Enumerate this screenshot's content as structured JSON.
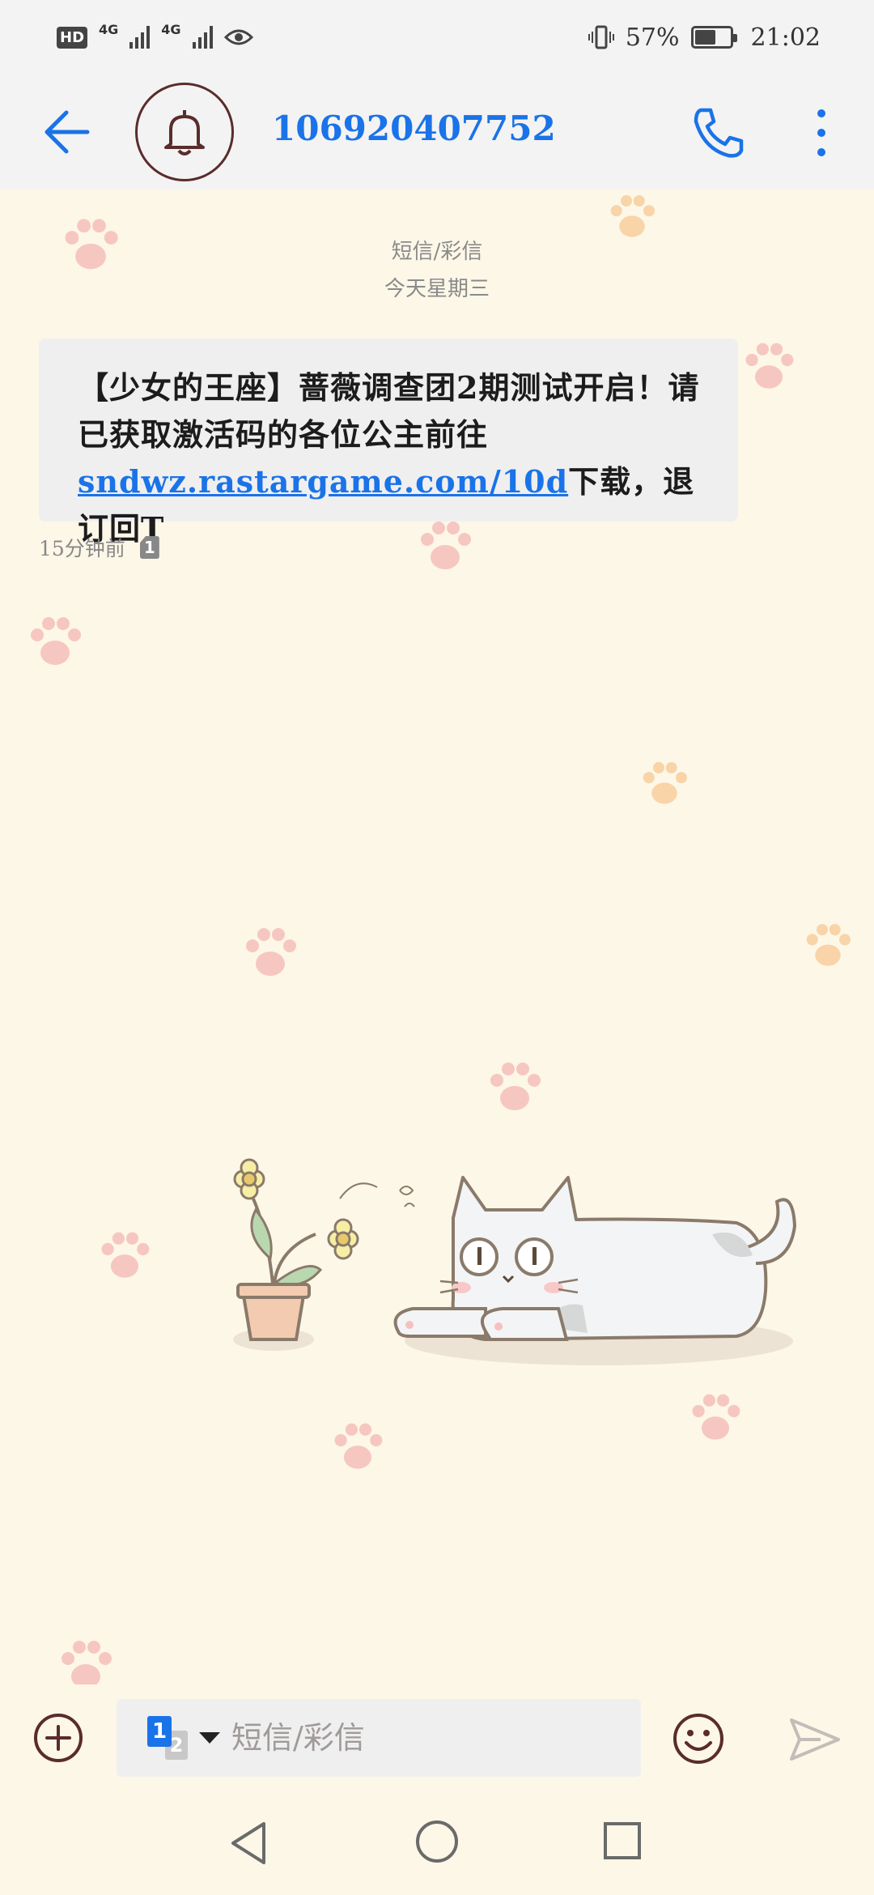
{
  "status_bar": {
    "hd": "HD",
    "net1": "4G",
    "net2": "4G",
    "battery": "57%",
    "battery_level": 0.57,
    "time": "21:02"
  },
  "header": {
    "contact": "106920407752"
  },
  "thread": {
    "channel_label": "短信/彩信",
    "date_label": "今天星期三",
    "message": {
      "text_part1": "【少女的王座】蔷薇调查团2期测试开启！请已获取激活码的各位公主前往",
      "link": "sndwz.rastargame.com/10d",
      "text_part2": "下载，退订回T",
      "time": "15分钟前",
      "sim": "1"
    }
  },
  "compose": {
    "placeholder": "短信/彩信",
    "sim_primary": "1",
    "sim_secondary": "2"
  },
  "colors": {
    "accent": "#1a73e8",
    "background": "#fdf7e8",
    "header_bg": "#f3f3f3",
    "bubble_bg": "#efefef"
  },
  "icons": [
    "back-arrow-icon",
    "bell-icon",
    "phone-icon",
    "more-vert-icon",
    "add-circle-icon",
    "emoji-icon",
    "send-icon",
    "nav-back-icon",
    "nav-home-icon",
    "nav-recent-icon"
  ]
}
